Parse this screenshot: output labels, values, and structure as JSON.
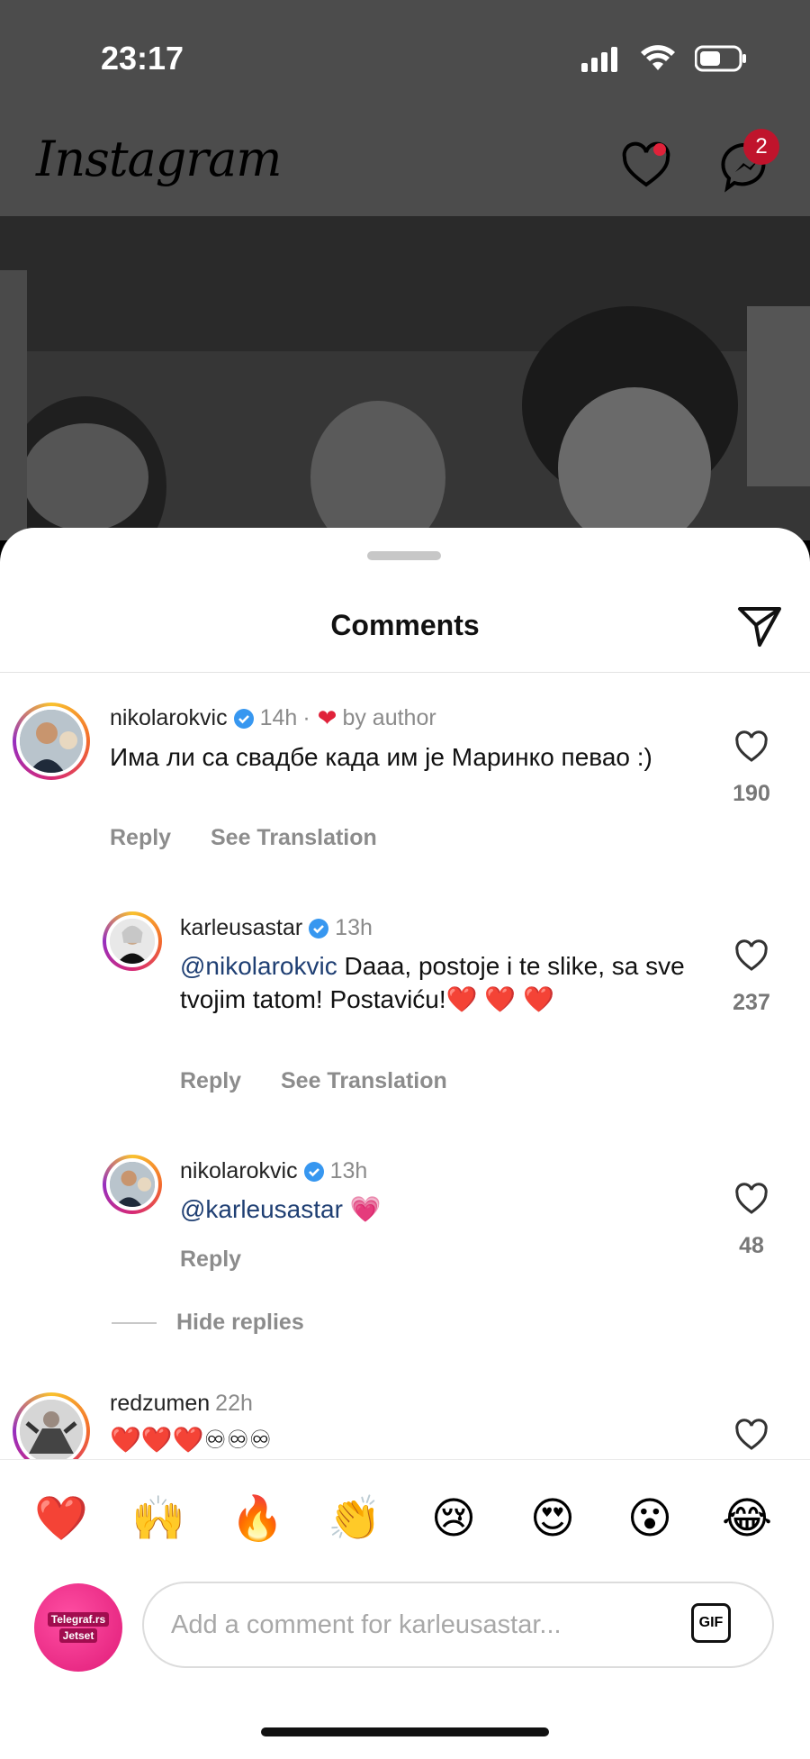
{
  "status": {
    "time": "23:17"
  },
  "header": {
    "app_title": "Instagram",
    "messages_badge": "2"
  },
  "sheet": {
    "title": "Comments"
  },
  "comments": [
    {
      "username": "nikolarokvic",
      "time": "14h",
      "separator": "·",
      "liked_by": "by author",
      "text": "Има ли са свадбе када им је Маринко певао :)",
      "reply_label": "Reply",
      "translate_label": "See Translation",
      "likes": "190"
    },
    {
      "username": "karleusastar",
      "time": "13h",
      "mention": "@nikolarokvic",
      "text": " Daaa, postoje i te slike, sa sve tvojim tatom! Postaviću!❤️ ❤️ ❤️",
      "reply_label": "Reply",
      "translate_label": "See Translation",
      "likes": "237"
    },
    {
      "username": "nikolarokvic",
      "time": "13h",
      "mention": "@karleusastar",
      "text": " 💗",
      "reply_label": "Reply",
      "likes": "48"
    },
    {
      "username": "redzumen",
      "time": "22h",
      "text": "❤️❤️❤️♾♾♾"
    }
  ],
  "hide_replies_label": "Hide replies",
  "reactions": [
    "❤️",
    "🙌",
    "🔥",
    "👏",
    "😢",
    "😍",
    "😮",
    "😂"
  ],
  "composer": {
    "placeholder": "Add a comment for karleusastar...",
    "gif_label": "GIF",
    "avatar_line1": "Telegraf.rs",
    "avatar_line2": "Jetset"
  }
}
